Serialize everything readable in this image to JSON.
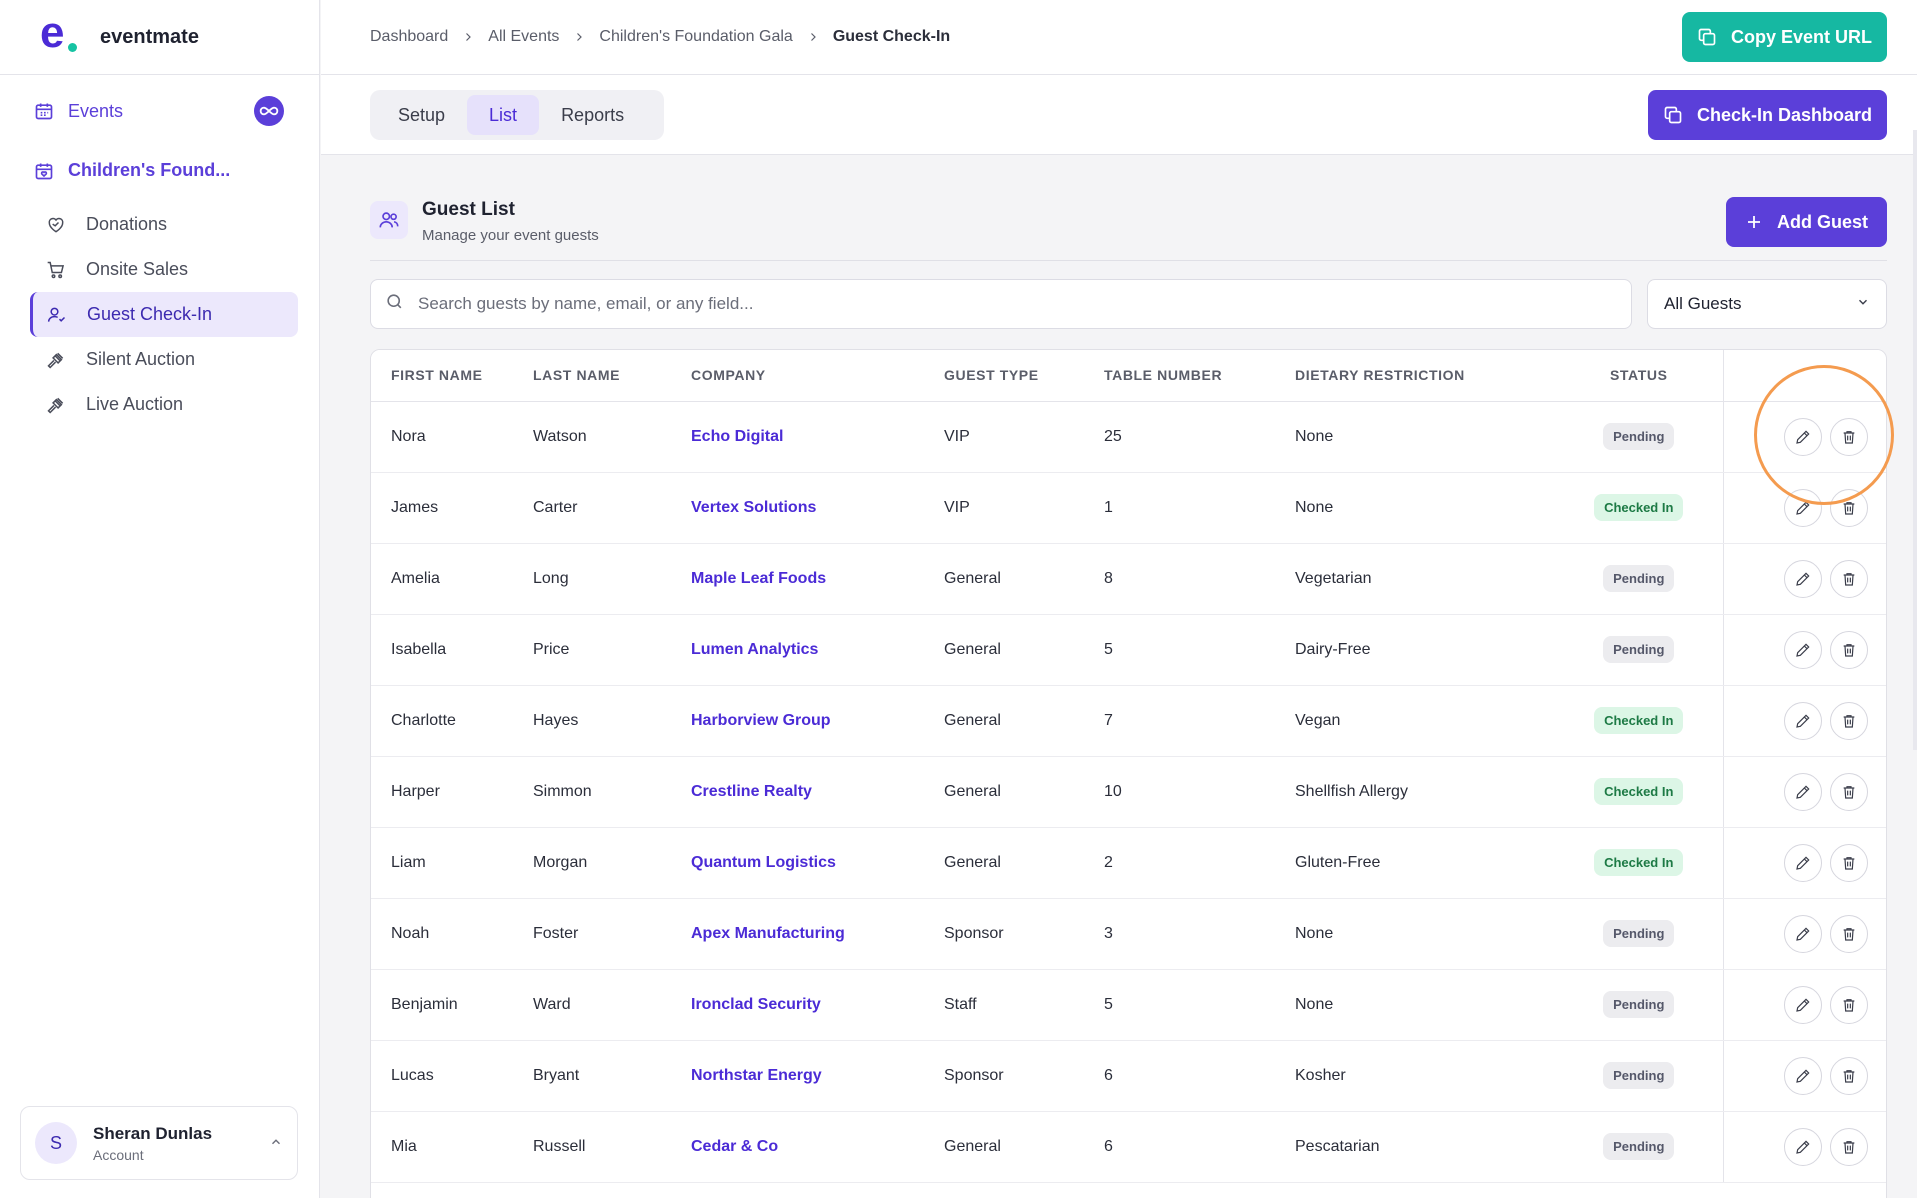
{
  "brand": {
    "name": "eventmate",
    "logo_letter": "e"
  },
  "sidebar": {
    "events_label": "Events",
    "event_title": "Children's Found...",
    "items": [
      {
        "label": "Donations",
        "icon": "heart-handshake-icon",
        "active": false
      },
      {
        "label": "Onsite Sales",
        "icon": "cart-icon",
        "active": false
      },
      {
        "label": "Guest Check-In",
        "icon": "user-check-icon",
        "active": true
      },
      {
        "label": "Silent Auction",
        "icon": "gavel-icon",
        "active": false
      },
      {
        "label": "Live Auction",
        "icon": "gavel-icon",
        "active": false
      }
    ],
    "account": {
      "initial": "S",
      "name": "Sheran Dunlas",
      "sub": "Account"
    }
  },
  "breadcrumb": {
    "items": [
      "Dashboard",
      "All Events",
      "Children's Foundation Gala"
    ],
    "current": "Guest Check-In"
  },
  "header": {
    "copy_url_label": "Copy Event URL"
  },
  "tabs": [
    {
      "label": "Setup",
      "active": false
    },
    {
      "label": "List",
      "active": true
    },
    {
      "label": "Reports",
      "active": false
    }
  ],
  "checkin_dashboard_label": "Check-In Dashboard",
  "guest_list": {
    "title": "Guest List",
    "subtitle": "Manage your event guests",
    "add_label": "Add Guest",
    "search_placeholder": "Search guests by name, email, or any field...",
    "filter_value": "All Guests"
  },
  "table": {
    "columns": [
      "FIRST NAME",
      "LAST NAME",
      "COMPANY",
      "GUEST TYPE",
      "TABLE NUMBER",
      "DIETARY RESTRICTION",
      "STATUS"
    ],
    "rows": [
      {
        "first": "Nora",
        "last": "Watson",
        "company": "Echo Digital",
        "type": "VIP",
        "table": "25",
        "diet": "None",
        "status": "Pending"
      },
      {
        "first": "James",
        "last": "Carter",
        "company": "Vertex Solutions",
        "type": "VIP",
        "table": "1",
        "diet": "None",
        "status": "Checked In"
      },
      {
        "first": "Amelia",
        "last": "Long",
        "company": "Maple Leaf Foods",
        "type": "General",
        "table": "8",
        "diet": "Vegetarian",
        "status": "Pending"
      },
      {
        "first": "Isabella",
        "last": "Price",
        "company": "Lumen Analytics",
        "type": "General",
        "table": "5",
        "diet": "Dairy-Free",
        "status": "Pending"
      },
      {
        "first": "Charlotte",
        "last": "Hayes",
        "company": "Harborview Group",
        "type": "General",
        "table": "7",
        "diet": "Vegan",
        "status": "Checked In"
      },
      {
        "first": "Harper",
        "last": "Simmon",
        "company": "Crestline Realty",
        "type": "General",
        "table": "10",
        "diet": "Shellfish Allergy",
        "status": "Checked In"
      },
      {
        "first": "Liam",
        "last": "Morgan",
        "company": "Quantum Logistics",
        "type": "General",
        "table": "2",
        "diet": "Gluten-Free",
        "status": "Checked In"
      },
      {
        "first": "Noah",
        "last": "Foster",
        "company": "Apex Manufacturing",
        "type": "Sponsor",
        "table": "3",
        "diet": "None",
        "status": "Pending"
      },
      {
        "first": "Benjamin",
        "last": "Ward",
        "company": "Ironclad Security",
        "type": "Staff",
        "table": "5",
        "diet": "None",
        "status": "Pending"
      },
      {
        "first": "Lucas",
        "last": "Bryant",
        "company": "Northstar Energy",
        "type": "Sponsor",
        "table": "6",
        "diet": "Kosher",
        "status": "Pending"
      },
      {
        "first": "Mia",
        "last": "Russell",
        "company": "Cedar & Co",
        "type": "General",
        "table": "6",
        "diet": "Pescatarian",
        "status": "Pending"
      }
    ]
  },
  "colors": {
    "brand_purple": "#5b3fd9",
    "teal": "#16b8a2",
    "checked_bg": "#dcf6e6",
    "pending_bg": "#ececef",
    "highlight_ring": "#f49b4f"
  }
}
